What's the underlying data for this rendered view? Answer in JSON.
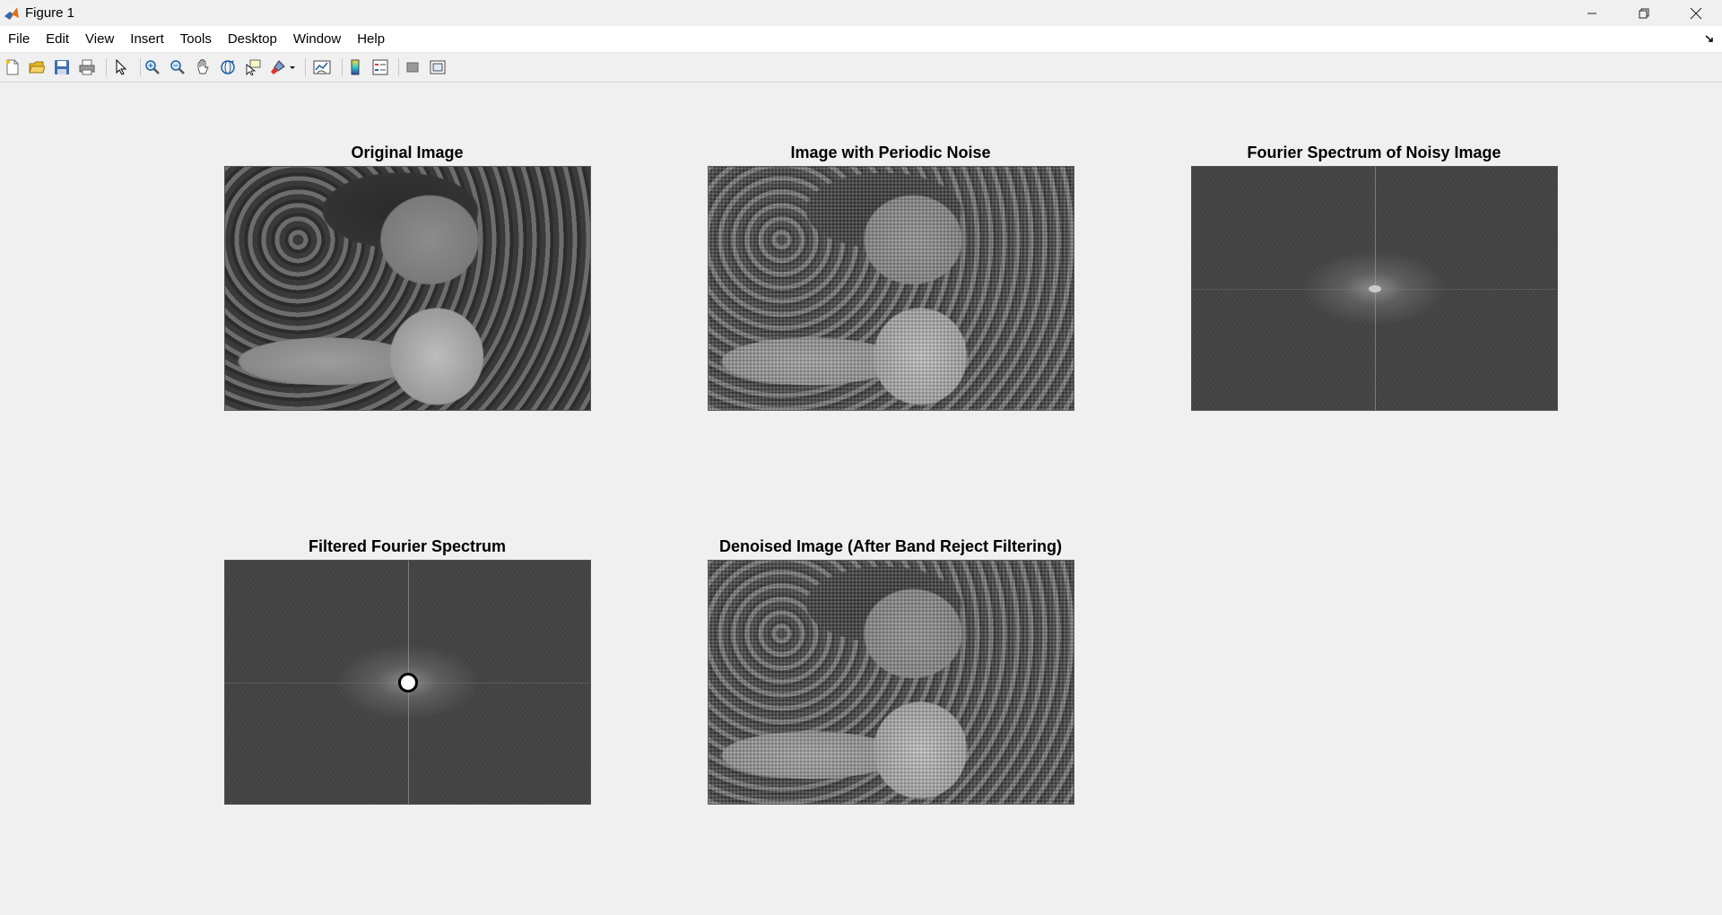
{
  "window": {
    "title": "Figure 1"
  },
  "menu": [
    "File",
    "Edit",
    "View",
    "Insert",
    "Tools",
    "Desktop",
    "Window",
    "Help"
  ],
  "toolbar": {
    "buttons": [
      "new-figure-icon",
      "open-file-icon",
      "save-icon",
      "print-icon",
      "edit-plot-arrow-icon",
      "zoom-in-icon",
      "zoom-out-icon",
      "pan-hand-icon",
      "rotate-3d-icon",
      "data-cursor-icon",
      "brush-icon",
      "link-plot-icon",
      "insert-colorbar-icon",
      "insert-legend-icon",
      "hide-plot-tools-icon",
      "show-plot-tools-icon"
    ]
  },
  "subplots": [
    {
      "title": "Original Image"
    },
    {
      "title": "Image with Periodic Noise"
    },
    {
      "title": "Fourier Spectrum of Noisy Image"
    },
    {
      "title": "Filtered Fourier Spectrum"
    },
    {
      "title": "Denoised Image (After Band Reject Filtering)"
    }
  ]
}
